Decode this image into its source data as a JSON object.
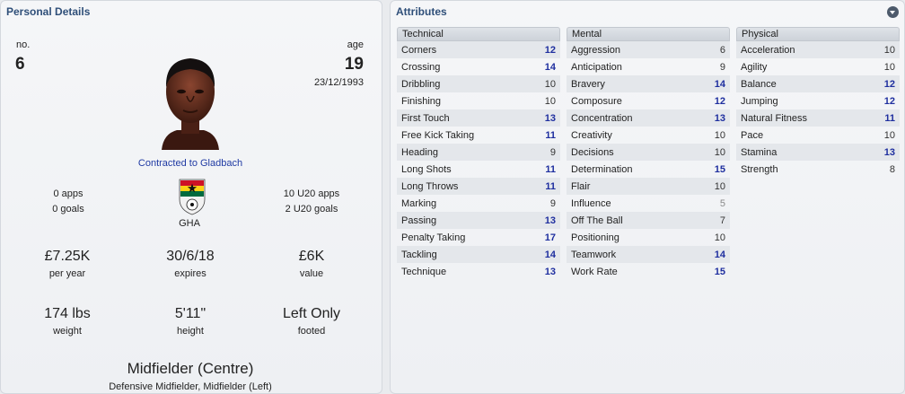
{
  "left_panel": {
    "title": "Personal Details",
    "number_label": "no.",
    "number_value": "6",
    "age_label": "age",
    "age_value": "19",
    "dob": "23/12/1993",
    "contract": "Contracted to Gladbach",
    "apps": "0 apps",
    "goals": "0 goals",
    "nation": "GHA",
    "u20_apps": "10 U20 apps",
    "u20_goals": "2 U20 goals",
    "wage_value": "£7.25K",
    "wage_label": "per year",
    "expires_value": "30/6/18",
    "expires_label": "expires",
    "value_value": "£6K",
    "value_label": "value",
    "weight_value": "174 lbs",
    "weight_label": "weight",
    "height_value": "5'11\"",
    "height_label": "height",
    "foot_value": "Left Only",
    "foot_label": "footed",
    "position": "Midfielder (Centre)",
    "positions_other": "Defensive Midfielder, Midfielder (Left)"
  },
  "right_panel": {
    "title": "Attributes",
    "collapse_icon": "chevron-down-icon",
    "columns": [
      {
        "header": "Technical",
        "rows": [
          {
            "name": "Corners",
            "value": "12",
            "style": "blue"
          },
          {
            "name": "Crossing",
            "value": "14",
            "style": "blue"
          },
          {
            "name": "Dribbling",
            "value": "10",
            "style": "normal"
          },
          {
            "name": "Finishing",
            "value": "10",
            "style": "normal"
          },
          {
            "name": "First Touch",
            "value": "13",
            "style": "blue"
          },
          {
            "name": "Free Kick Taking",
            "value": "11",
            "style": "blue"
          },
          {
            "name": "Heading",
            "value": "9",
            "style": "normal"
          },
          {
            "name": "Long Shots",
            "value": "11",
            "style": "blue"
          },
          {
            "name": "Long Throws",
            "value": "11",
            "style": "blue"
          },
          {
            "name": "Marking",
            "value": "9",
            "style": "normal"
          },
          {
            "name": "Passing",
            "value": "13",
            "style": "blue"
          },
          {
            "name": "Penalty Taking",
            "value": "17",
            "style": "blue"
          },
          {
            "name": "Tackling",
            "value": "14",
            "style": "blue"
          },
          {
            "name": "Technique",
            "value": "13",
            "style": "blue"
          }
        ]
      },
      {
        "header": "Mental",
        "rows": [
          {
            "name": "Aggression",
            "value": "6",
            "style": "normal"
          },
          {
            "name": "Anticipation",
            "value": "9",
            "style": "normal"
          },
          {
            "name": "Bravery",
            "value": "14",
            "style": "blue"
          },
          {
            "name": "Composure",
            "value": "12",
            "style": "blue"
          },
          {
            "name": "Concentration",
            "value": "13",
            "style": "blue"
          },
          {
            "name": "Creativity",
            "value": "10",
            "style": "normal"
          },
          {
            "name": "Decisions",
            "value": "10",
            "style": "normal"
          },
          {
            "name": "Determination",
            "value": "15",
            "style": "blue"
          },
          {
            "name": "Flair",
            "value": "10",
            "style": "normal"
          },
          {
            "name": "Influence",
            "value": "5",
            "style": "grey"
          },
          {
            "name": "Off The Ball",
            "value": "7",
            "style": "normal"
          },
          {
            "name": "Positioning",
            "value": "10",
            "style": "normal"
          },
          {
            "name": "Teamwork",
            "value": "14",
            "style": "blue"
          },
          {
            "name": "Work Rate",
            "value": "15",
            "style": "blue"
          }
        ]
      },
      {
        "header": "Physical",
        "rows": [
          {
            "name": "Acceleration",
            "value": "10",
            "style": "normal"
          },
          {
            "name": "Agility",
            "value": "10",
            "style": "normal"
          },
          {
            "name": "Balance",
            "value": "12",
            "style": "blue"
          },
          {
            "name": "Jumping",
            "value": "12",
            "style": "blue"
          },
          {
            "name": "Natural Fitness",
            "value": "11",
            "style": "blue"
          },
          {
            "name": "Pace",
            "value": "10",
            "style": "normal"
          },
          {
            "name": "Stamina",
            "value": "13",
            "style": "blue"
          },
          {
            "name": "Strength",
            "value": "8",
            "style": "normal"
          }
        ]
      }
    ]
  }
}
